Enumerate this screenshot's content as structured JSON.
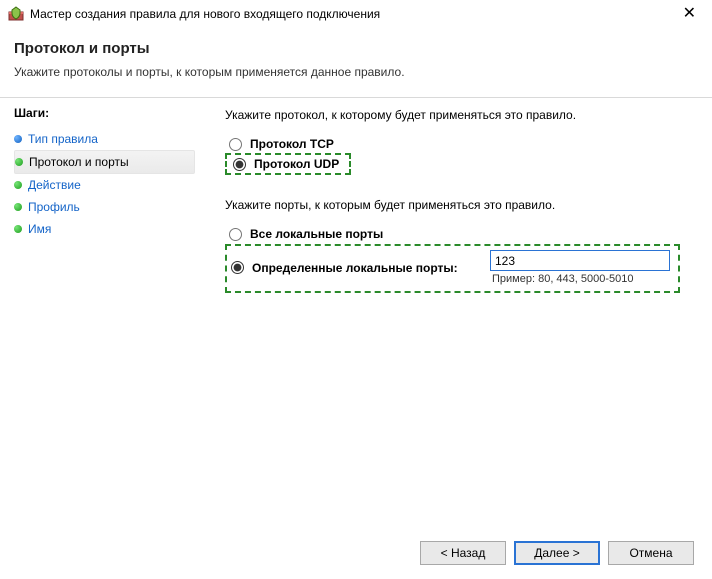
{
  "window": {
    "title": "Мастер создания правила для нового входящего подключения"
  },
  "header": {
    "title": "Протокол и порты",
    "subtitle": "Укажите протоколы и порты, к которым применяется данное правило."
  },
  "steps": {
    "heading": "Шаги:",
    "items": [
      {
        "label": "Тип правила",
        "bullet": "blue",
        "current": false,
        "link": true
      },
      {
        "label": "Протокол и порты",
        "bullet": "green",
        "current": true,
        "link": false
      },
      {
        "label": "Действие",
        "bullet": "green",
        "current": false,
        "link": true
      },
      {
        "label": "Профиль",
        "bullet": "green",
        "current": false,
        "link": true
      },
      {
        "label": "Имя",
        "bullet": "green",
        "current": false,
        "link": true
      }
    ]
  },
  "content": {
    "protocol_prompt": "Укажите протокол, к которому будет применяться это правило.",
    "protocol_tcp": "Протокол TCP",
    "protocol_udp": "Протокол UDP",
    "protocol_selected": "udp",
    "ports_prompt": "Укажите порты, к которым будет применяться это правило.",
    "ports_all": "Все локальные порты",
    "ports_specific": "Определенные локальные порты:",
    "ports_selected": "specific",
    "ports_value": "123",
    "ports_example": "Пример: 80, 443, 5000-5010"
  },
  "buttons": {
    "back": "< Назад",
    "next": "Далее >",
    "cancel": "Отмена"
  }
}
